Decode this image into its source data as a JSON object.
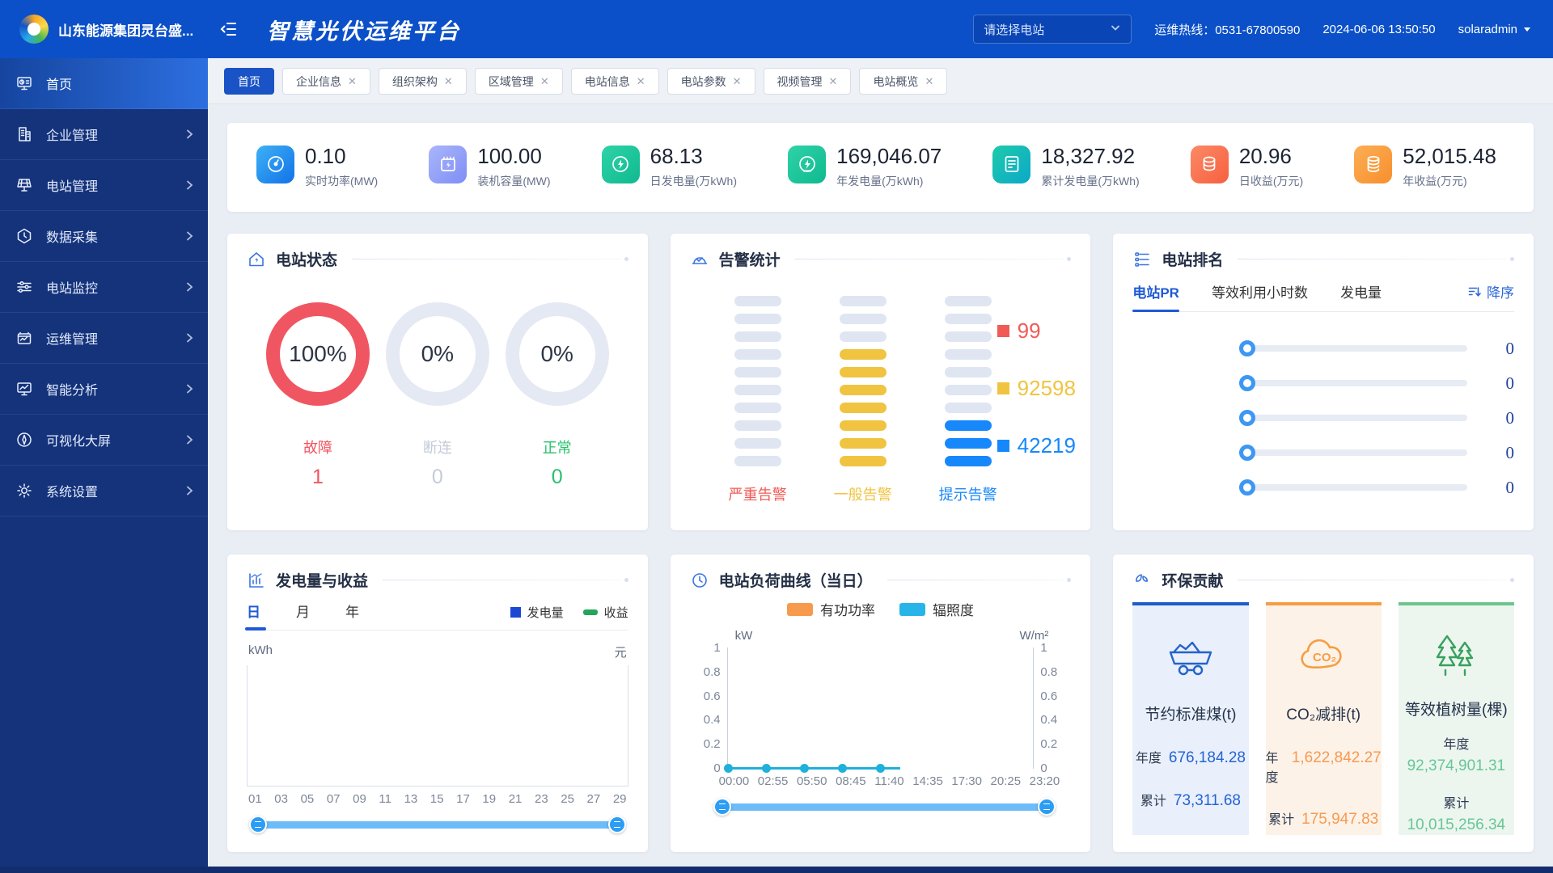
{
  "header": {
    "company": "山东能源集团灵台盛...",
    "app_title": "智慧光伏运维平台",
    "station_select_placeholder": "请选择电站",
    "hotline_label": "运维热线：",
    "hotline_number": "0531-67800590",
    "datetime": "2024-06-06 13:50:50",
    "username": "solaradmin"
  },
  "sidebar": {
    "items": [
      {
        "label": "首页",
        "icon": "home-icon",
        "active": true,
        "has_children": false
      },
      {
        "label": "企业管理",
        "icon": "enterprise-icon",
        "active": false,
        "has_children": true
      },
      {
        "label": "电站管理",
        "icon": "plant-icon",
        "active": false,
        "has_children": true
      },
      {
        "label": "数据采集",
        "icon": "data-collect-icon",
        "active": false,
        "has_children": true
      },
      {
        "label": "电站监控",
        "icon": "monitor-icon",
        "active": false,
        "has_children": true
      },
      {
        "label": "运维管理",
        "icon": "ops-icon",
        "active": false,
        "has_children": true
      },
      {
        "label": "智能分析",
        "icon": "analysis-icon",
        "active": false,
        "has_children": true
      },
      {
        "label": "可视化大屏",
        "icon": "bigscreen-icon",
        "active": false,
        "has_children": true
      },
      {
        "label": "系统设置",
        "icon": "settings-icon",
        "active": false,
        "has_children": true
      }
    ]
  },
  "tabs": [
    {
      "label": "首页",
      "active": true,
      "closable": false
    },
    {
      "label": "企业信息",
      "active": false,
      "closable": true
    },
    {
      "label": "组织架构",
      "active": false,
      "closable": true
    },
    {
      "label": "区域管理",
      "active": false,
      "closable": true
    },
    {
      "label": "电站信息",
      "active": false,
      "closable": true
    },
    {
      "label": "电站参数",
      "active": false,
      "closable": true
    },
    {
      "label": "视频管理",
      "active": false,
      "closable": true
    },
    {
      "label": "电站概览",
      "active": false,
      "closable": true
    }
  ],
  "kpis": [
    {
      "icon": "gauge-icon",
      "value": "0.10",
      "label": "实时功率(MW)",
      "color1": "#3db1f5",
      "color2": "#1272e8"
    },
    {
      "icon": "capacity-icon",
      "value": "100.00",
      "label": "装机容量(MW)",
      "color1": "#aab6fa",
      "color2": "#7e8ef5"
    },
    {
      "icon": "day-energy-icon",
      "value": "68.13",
      "label": "日发电量(万kWh)",
      "color1": "#2fd3a8",
      "color2": "#0fb98f"
    },
    {
      "icon": "year-energy-icon",
      "value": "169,046.07",
      "label": "年发电量(万kWh)",
      "color1": "#2fd3a8",
      "color2": "#0fb98f"
    },
    {
      "icon": "total-energy-icon",
      "value": "18,327.92",
      "label": "累计发电量(万kWh)",
      "color1": "#1ecbaa",
      "color2": "#0ba8c9"
    },
    {
      "icon": "day-revenue-icon",
      "value": "20.96",
      "label": "日收益(万元)",
      "color1": "#fc8a66",
      "color2": "#f6603f"
    },
    {
      "icon": "year-revenue-icon",
      "value": "52,015.48",
      "label": "年收益(万元)",
      "color1": "#fcae55",
      "color2": "#f78f2e"
    }
  ],
  "panels": {
    "station_status": {
      "title": "电站状态",
      "items": [
        {
          "percent": "100%",
          "label": "故障",
          "count": "1",
          "color": "#f05661",
          "ring_color": "#f05661"
        },
        {
          "percent": "0%",
          "label": "断连",
          "count": "0",
          "color": "#c3cbd9",
          "ring_color": "#e4e9f3"
        },
        {
          "percent": "0%",
          "label": "正常",
          "count": "0",
          "color": "#27c26c",
          "ring_color": "#e4e9f3"
        }
      ]
    },
    "alarm_stats": {
      "title": "告警统计",
      "pills_per_column": 10,
      "pill_empty_color": "#dfe6f2",
      "columns": [
        {
          "label": "严重告警",
          "count": "99",
          "color": "#f05b56",
          "filled": 0
        },
        {
          "label": "一般告警",
          "count": "92598",
          "color": "#f0c441",
          "filled": 7
        },
        {
          "label": "提示告警",
          "count": "42219",
          "color": "#1788fb",
          "filled": 3
        }
      ]
    },
    "station_ranking": {
      "title": "电站排名",
      "tabs": [
        {
          "label": "电站PR",
          "active": true
        },
        {
          "label": "等效利用小时数",
          "active": false
        },
        {
          "label": "发电量",
          "active": false
        }
      ],
      "sort_label": "降序",
      "rows": [
        {
          "value": "0"
        },
        {
          "value": "0"
        },
        {
          "value": "0"
        },
        {
          "value": "0"
        },
        {
          "value": "0"
        }
      ]
    },
    "energy_revenue": {
      "title": "发电量与收益",
      "tabs": [
        {
          "label": "日",
          "active": true
        },
        {
          "label": "月",
          "active": false
        },
        {
          "label": "年",
          "active": false
        }
      ],
      "legend": [
        {
          "label": "发电量",
          "color": "#1c49d4"
        },
        {
          "label": "收益",
          "color": "#23a55b"
        }
      ],
      "y_left_unit": "kWh",
      "y_right_unit": "元",
      "x_ticks": [
        "01",
        "03",
        "05",
        "07",
        "09",
        "11",
        "13",
        "15",
        "17",
        "19",
        "21",
        "23",
        "25",
        "27",
        "29"
      ]
    },
    "load_curve": {
      "title": "电站负荷曲线（当日）",
      "legend": [
        {
          "label": "有功功率",
          "color": "#f89a4b"
        },
        {
          "label": "辐照度",
          "color": "#27b5e9"
        }
      ],
      "y_left_unit": "kW",
      "y_right_unit": "W/m²",
      "y_ticks": [
        "1",
        "0.8",
        "0.6",
        "0.4",
        "0.2",
        "0"
      ],
      "x_ticks": [
        "00:00",
        "02:55",
        "05:50",
        "08:45",
        "11:40",
        "14:35",
        "17:30",
        "20:25",
        "23:20"
      ],
      "series": [
        {
          "name": "辐照度",
          "color": "#1fb0dc",
          "values": [
            0,
            0,
            0,
            0,
            0
          ]
        }
      ],
      "dot_fractions": [
        0,
        0.125,
        0.25,
        0.375,
        0.5
      ],
      "line_end_fraction": 0.565
    },
    "environment": {
      "title": "环保贡献",
      "annual_label": "年度",
      "total_label": "累计",
      "cards": [
        {
          "icon": "coal-cart-icon",
          "label": "节约标准煤(t)",
          "annual": "676,184.28",
          "total": "73,311.68",
          "accent": "#1f5cc9"
        },
        {
          "icon": "co2-cloud-icon",
          "label": "CO₂减排(t)",
          "annual": "1,622,842.27",
          "total": "175,947.83",
          "accent": "#f69d43"
        },
        {
          "icon": "trees-icon",
          "label": "等效植树量(棵)",
          "annual": "92,374,901.31",
          "total": "10,015,256.34",
          "accent": "#6cc48e"
        }
      ]
    }
  }
}
